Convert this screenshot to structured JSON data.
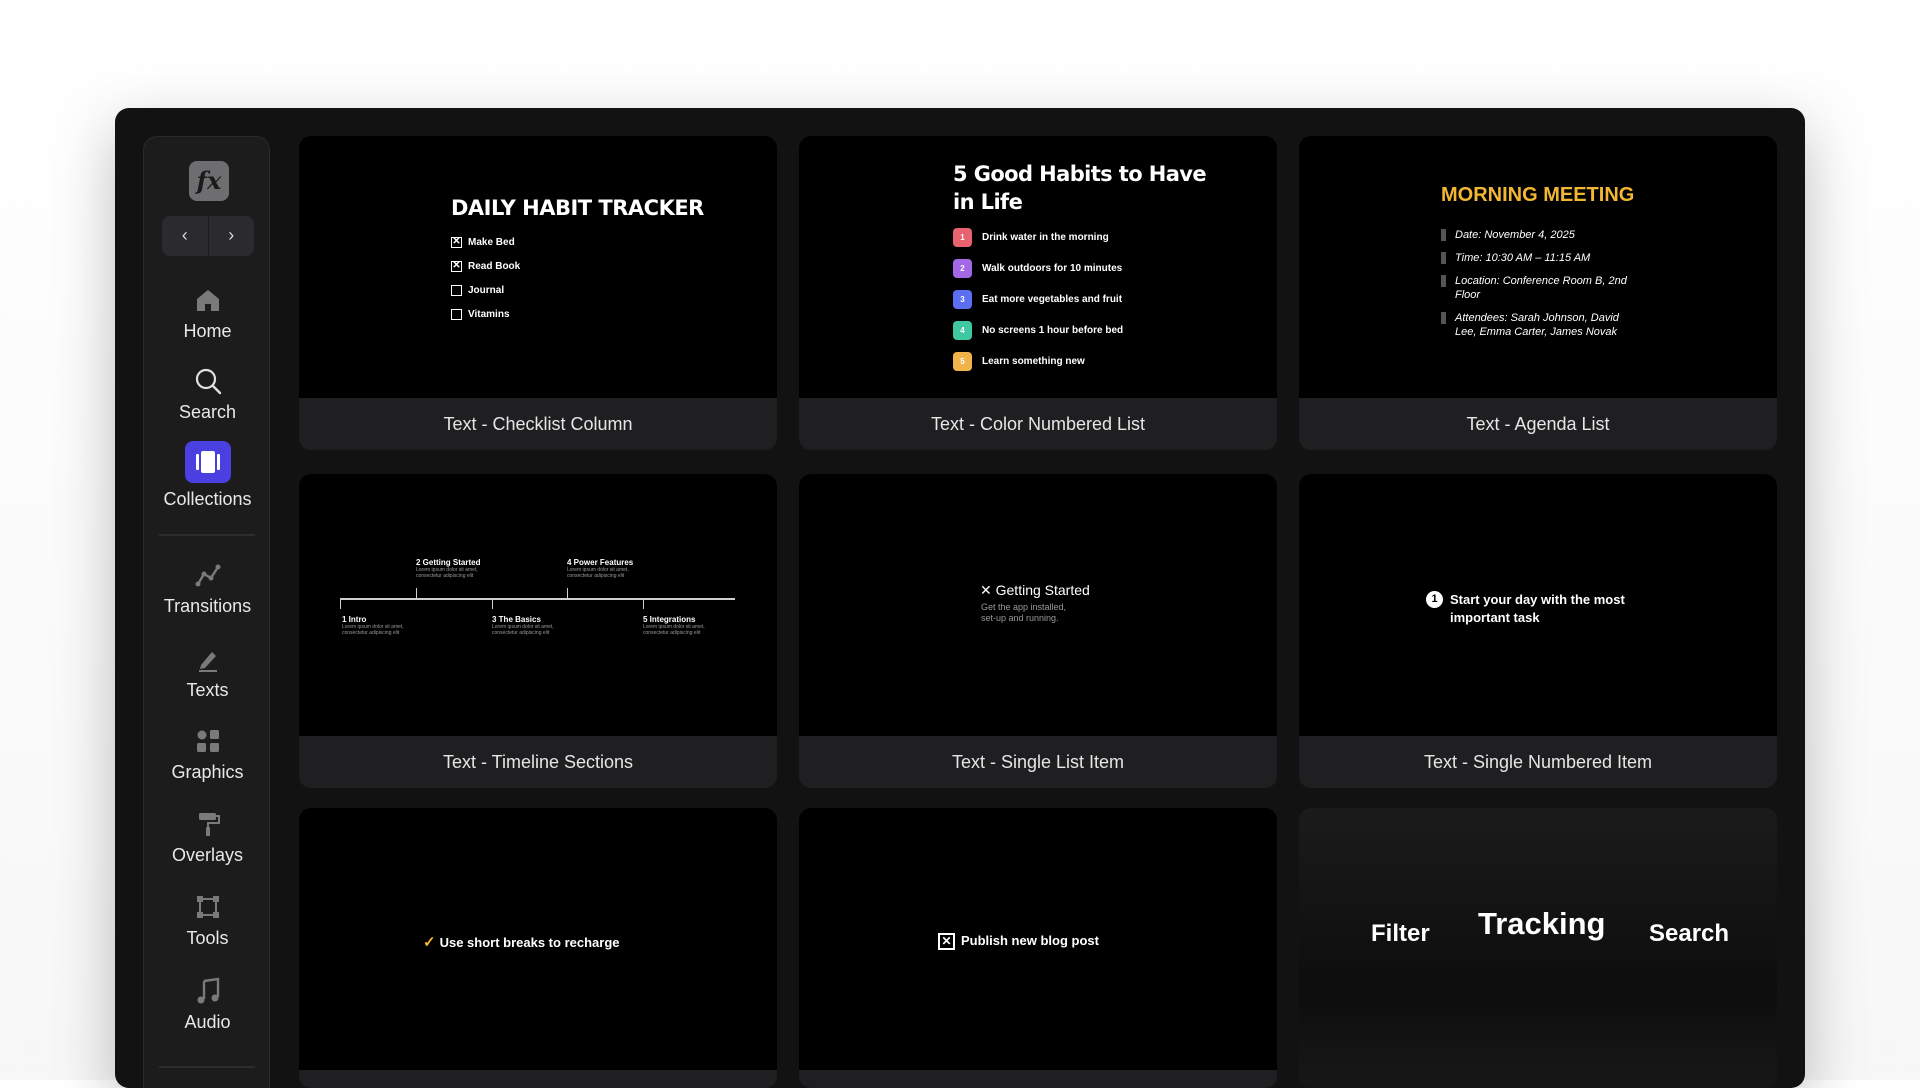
{
  "sidebar": {
    "logo_text": "fx",
    "back_arrow": "‹",
    "forward_arrow": "›",
    "items": [
      {
        "label": "Home",
        "icon": "home-icon"
      },
      {
        "label": "Search",
        "icon": "search-icon"
      },
      {
        "label": "Collections",
        "icon": "collections-icon",
        "active": true,
        "accent": "#4a3fe0"
      },
      {
        "label": "Transitions",
        "icon": "transitions-icon"
      },
      {
        "label": "Texts",
        "icon": "pen-icon"
      },
      {
        "label": "Graphics",
        "icon": "shapes-icon"
      },
      {
        "label": "Overlays",
        "icon": "paint-roller-icon"
      },
      {
        "label": "Tools",
        "icon": "tools-icon"
      },
      {
        "label": "Audio",
        "icon": "music-note-icon"
      }
    ]
  },
  "cards": [
    {
      "label": "Text - Checklist Column",
      "preview": {
        "title": "DAILY HABIT TRACKER",
        "items": [
          {
            "text": "Make Bed",
            "checked": true
          },
          {
            "text": "Read Book",
            "checked": true
          },
          {
            "text": "Journal",
            "checked": false
          },
          {
            "text": "Vitamins",
            "checked": false
          }
        ]
      }
    },
    {
      "label": "Text - Color Numbered List",
      "preview": {
        "title_line1": "5 Good Habits to Have",
        "title_line2": "in Life",
        "items": [
          {
            "num": "1",
            "text": "Drink water in the morning",
            "color": "#e9626f"
          },
          {
            "num": "2",
            "text": "Walk outdoors for 10 minutes",
            "color": "#a268e8"
          },
          {
            "num": "3",
            "text": "Eat more vegetables and fruit",
            "color": "#5b6ff0"
          },
          {
            "num": "4",
            "text": "No screens 1 hour before bed",
            "color": "#3ec7a0"
          },
          {
            "num": "5",
            "text": "Learn something new",
            "color": "#f0b44a"
          }
        ]
      }
    },
    {
      "label": "Text - Agenda List",
      "preview": {
        "title": "MORNING MEETING",
        "title_color": "#f2b731",
        "items": [
          "Date: November 4, 2025",
          "Time: 10:30 AM – 11:15 AM",
          "Location: Conference Room B, 2nd Floor",
          "Attendees: Sarah Johnson, David Lee, Emma Carter, James Novak"
        ]
      }
    },
    {
      "label": "Text - Timeline Sections",
      "preview": {
        "top": [
          {
            "title": "2 Getting Started",
            "sub": "Lorem ipsum dolor sit amet, consectetur adipiscing elit"
          },
          {
            "title": "4 Power Features",
            "sub": "Lorem ipsum dolor sit amet, consectetur adipiscing elit"
          }
        ],
        "bottom": [
          {
            "title": "1 Intro",
            "sub": "Lorem ipsum dolor sit amet, consectetur adipiscing elit"
          },
          {
            "title": "3 The Basics",
            "sub": "Lorem ipsum dolor sit amet, consectetur adipiscing elit"
          },
          {
            "title": "5 Integrations",
            "sub": "Lorem ipsum dolor sit amet, consectetur adipiscing elit"
          }
        ]
      }
    },
    {
      "label": "Text - Single List Item",
      "preview": {
        "marker": "✕",
        "title": "Getting Started",
        "sub_line1": "Get the app installed,",
        "sub_line2": "set-up and running."
      }
    },
    {
      "label": "Text - Single Numbered Item",
      "preview": {
        "num": "1",
        "line1": "Start your day with the most",
        "line2": "important task"
      }
    },
    {
      "label": "",
      "preview": {
        "marker": "✓",
        "text": "Use short breaks to recharge",
        "marker_color": "#f2b731"
      }
    },
    {
      "label": "",
      "preview": {
        "marker": "✕",
        "text": "Publish new blog post"
      }
    },
    {
      "label": "",
      "preview": {
        "words": [
          "Filter",
          "Tracking",
          "Search"
        ]
      }
    }
  ]
}
